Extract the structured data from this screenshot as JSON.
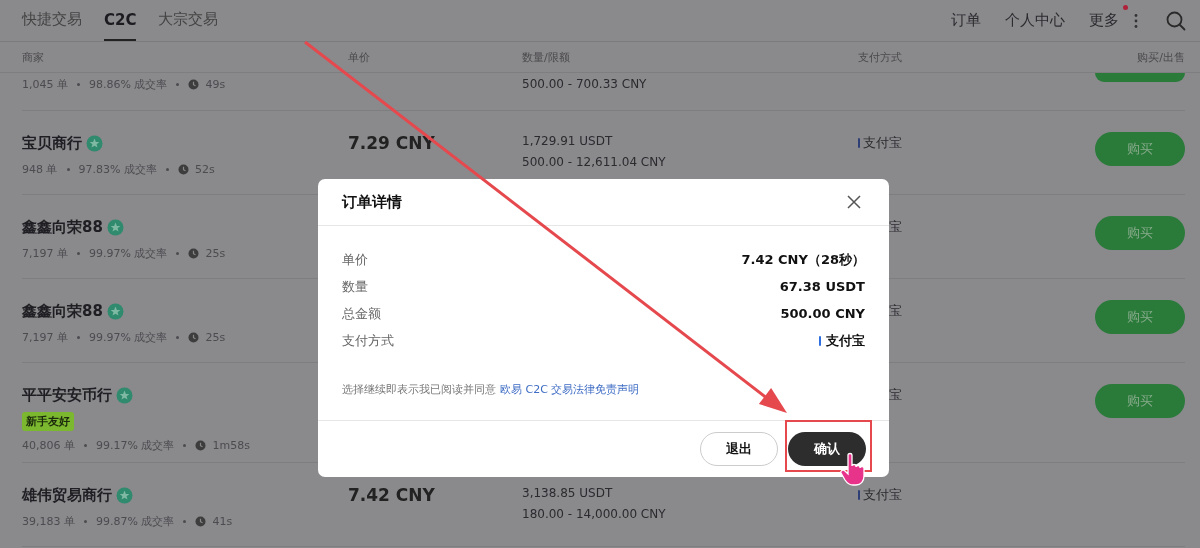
{
  "tabs": [
    {
      "label": "快捷交易",
      "selected": false
    },
    {
      "label": "C2C",
      "selected": true
    },
    {
      "label": "大宗交易",
      "selected": false
    }
  ],
  "nav_links": [
    {
      "label": "订单",
      "kind": "link",
      "notification": false
    },
    {
      "label": "个人中心",
      "kind": "link",
      "notification": false
    },
    {
      "label": "更多",
      "kind": "menu",
      "notification": true
    }
  ],
  "table": {
    "columns": [
      "商家",
      "单价",
      "数量/限额",
      "支付方式",
      "购买/出售"
    ],
    "rows": [
      {
        "kind": "cut_top",
        "orders": "1,045 单",
        "completion": "98.86% 成交率",
        "time": "49s",
        "limit": "500.00 - 700.33 CNY"
      },
      {
        "kind": "full",
        "merchant": "宝贝商行",
        "verified": true,
        "orders": "948 单",
        "completion": "97.83% 成交率",
        "time": "52s",
        "price": "7.29 CNY",
        "quantity": "1,729.91 USDT",
        "limit": "500.00 - 12,611.04 CNY",
        "payment": "支付宝",
        "action": "购买"
      },
      {
        "kind": "under_dialog",
        "merchant": "鑫鑫向荣88",
        "verified": true,
        "orders": "7,197 单",
        "completion": "99.97% 成交率",
        "time": "25s",
        "payment": "宝",
        "action": "购买"
      },
      {
        "kind": "under_dialog",
        "merchant": "鑫鑫向荣88",
        "verified": true,
        "orders": "7,197 单",
        "completion": "99.97% 成交率",
        "time": "25s",
        "payment": "宝",
        "action": "购买"
      },
      {
        "kind": "under_dialog",
        "merchant": "平平安安币行",
        "verified": true,
        "tag": "新手友好",
        "orders": "40,806 单",
        "completion": "99.17% 成交率",
        "time": "1m58s",
        "payment": "宝",
        "action": "购买"
      },
      {
        "kind": "full",
        "merchant": "雄伟贸易商行",
        "verified": true,
        "orders": "39,183 单",
        "completion": "99.87% 成交率",
        "time": "41s",
        "price": "7.42 CNY",
        "quantity": "3,138.85 USDT",
        "limit": "180.00 - 14,000.00 CNY",
        "payment": "支付宝"
      }
    ]
  },
  "dialog": {
    "title": "订单详情",
    "details": [
      {
        "label": "单价",
        "value": "7.42 CNY（28秒）",
        "kind": "text"
      },
      {
        "label": "数量",
        "value": "67.38 USDT",
        "kind": "text"
      },
      {
        "label": "总金额",
        "value": "500.00 CNY",
        "kind": "text"
      },
      {
        "label": "支付方式",
        "value": "支付宝",
        "kind": "payment"
      }
    ],
    "notice": "选择继续即表示我已阅读并同意",
    "notice_link": "欧易 C2C 交易法律免责声明",
    "buttons": [
      {
        "label": "退出",
        "kind": "secondary"
      },
      {
        "label": "确认",
        "kind": "primary"
      }
    ]
  }
}
